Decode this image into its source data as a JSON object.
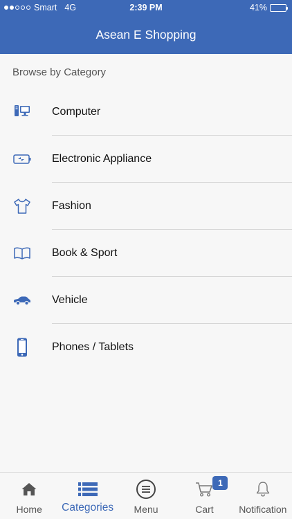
{
  "status_bar": {
    "carrier": "Smart",
    "network": "4G",
    "time": "2:39 PM",
    "battery_percent_label": "41%",
    "battery_level": 0.41,
    "signal_bars_filled": 2,
    "signal_bars_total": 5
  },
  "header": {
    "title": "Asean E Shopping"
  },
  "section": {
    "title": "Browse by Category"
  },
  "categories": [
    {
      "label": "Computer",
      "icon": "computer-icon"
    },
    {
      "label": "Electronic Appliance",
      "icon": "battery-icon"
    },
    {
      "label": "Fashion",
      "icon": "tshirt-icon"
    },
    {
      "label": "Book & Sport",
      "icon": "book-icon"
    },
    {
      "label": "Vehicle",
      "icon": "car-icon"
    },
    {
      "label": "Phones / Tablets",
      "icon": "phone-icon"
    }
  ],
  "tabbar": {
    "items": [
      {
        "label": "Home",
        "icon": "home-icon"
      },
      {
        "label": "Categories",
        "icon": "list-icon",
        "active": true
      },
      {
        "label": "Menu",
        "icon": "menu-icon"
      },
      {
        "label": "Cart",
        "icon": "cart-icon",
        "badge": "1"
      },
      {
        "label": "Notification",
        "icon": "bell-icon"
      }
    ]
  },
  "colors": {
    "primary": "#3d69b7",
    "background": "#f7f7f7",
    "divider": "#d6d6d6"
  }
}
